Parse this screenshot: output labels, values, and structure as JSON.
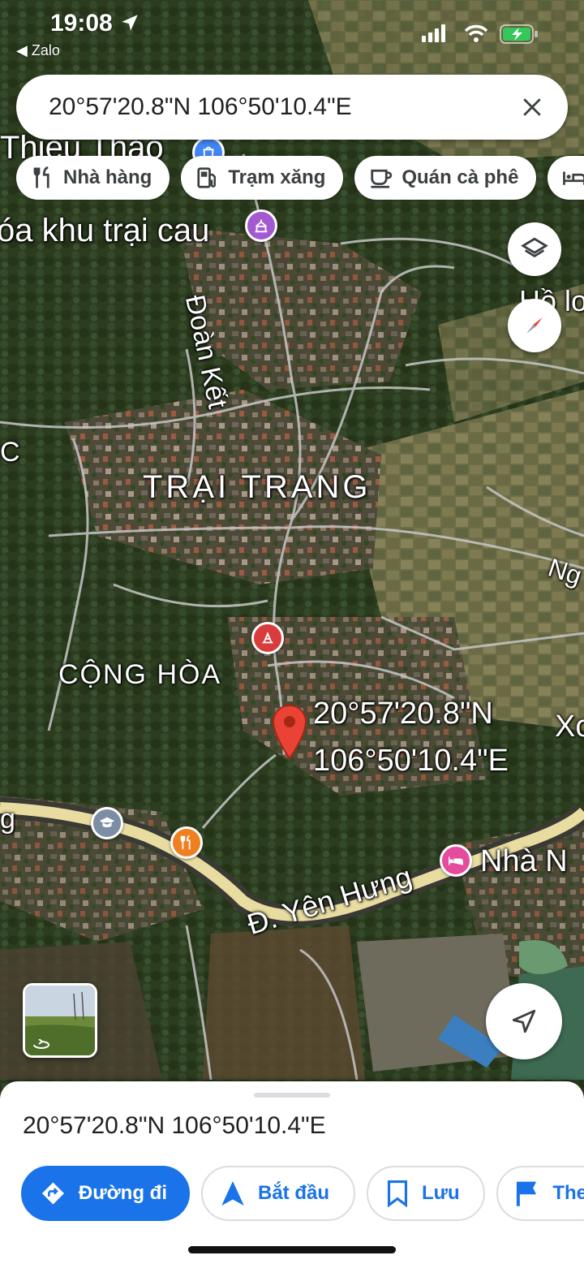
{
  "status_bar": {
    "time": "19:08",
    "back_app": "Zalo"
  },
  "search": {
    "query": "20°57'20.8\"N 106°50'10.4\"E"
  },
  "chips": [
    {
      "label": "Nhà hàng",
      "icon": "restaurant-icon"
    },
    {
      "label": "Trạm xăng",
      "icon": "gas-station-icon"
    },
    {
      "label": "Quán cà phê",
      "icon": "coffee-icon"
    },
    {
      "label": "",
      "icon": "hotel-icon"
    }
  ],
  "map": {
    "labels": {
      "thieu_thao": "Thiều Thảo",
      "khu_trai_cau": "óa khu trại cau",
      "doan_ket": "Đoàn Kết",
      "ho": "Hồ lo",
      "trai_trang": "TRẠI TRANG",
      "cong_hoa": "CỘNG HÒA",
      "ng": "Ng",
      "xo": "Xo",
      "c": "C",
      "g": "g",
      "yen_hung": "Đ. Yên Hưng",
      "nha_n": "Nhà N"
    },
    "pin": {
      "line1": "20°57'20.8\"N",
      "line2": "106°50'10.4\"E",
      "color": "#ea4335"
    }
  },
  "sheet": {
    "title": "20°57'20.8\"N 106°50'10.4\"E",
    "actions": [
      {
        "label": "Đường đi",
        "icon": "directions-icon",
        "primary": true
      },
      {
        "label": "Bắt đầu",
        "icon": "navigation-arrow-icon",
        "primary": false
      },
      {
        "label": "Lưu",
        "icon": "bookmark-icon",
        "primary": false
      },
      {
        "label": "The",
        "icon": "flag-icon",
        "primary": false
      }
    ]
  },
  "colors": {
    "accent": "#1a73e8",
    "pin": "#ea4335",
    "road_main": "#e8dca0",
    "poi_school": "#7b8ea3",
    "poi_restaurant": "#f07f20",
    "poi_hotel": "#e64a9d",
    "poi_temple": "#a35ad0",
    "poi_shop": "#4285f4",
    "poi_pharmacy": "#d93c3c"
  }
}
